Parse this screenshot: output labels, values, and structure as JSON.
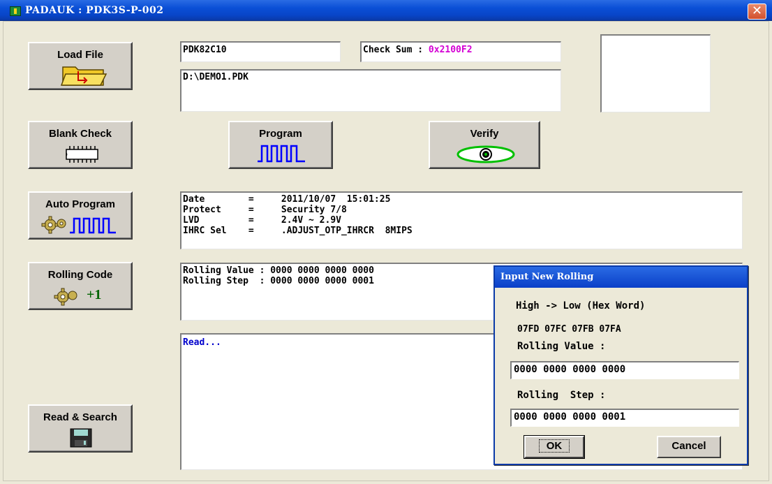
{
  "window": {
    "title": "PADAUK : PDK3S-P-002",
    "close": "✕"
  },
  "buttons": {
    "load_file": "Load File",
    "blank_check": "Blank Check",
    "program": "Program",
    "verify": "Verify",
    "auto_program": "Auto Program",
    "rolling_code": "Rolling Code",
    "rolling_code_increment": "+1",
    "read_search": "Read & Search"
  },
  "fields": {
    "ic_name": "PDK82C10",
    "checksum_label": "Check Sum : ",
    "checksum_value": "0x2100F2",
    "file_path": "D:\\DEMO1.PDK"
  },
  "info_lines": [
    "Date        =     2011/10/07  15:01:25",
    "Protect     =     Security 7/8",
    "LVD         =     2.4V ~ 2.9V",
    "IHRC Sel    =     .ADJUST_OTP_IHRCR  8MIPS"
  ],
  "rolling_lines": [
    "Rolling Value : 0000 0000 0000 0000",
    "Rolling Step  : 0000 0000 0000 0001"
  ],
  "log": {
    "text": "Read..."
  },
  "dialog": {
    "title": "Input New Rolling",
    "hint": "High -> Low (Hex Word)",
    "addresses": "07FD 07FC 07FB 07FA",
    "value_label": "Rolling Value :",
    "value": "0000 0000 0000 0000",
    "step_label": "Rolling  Step :",
    "step": "0000 0000 0000 0001",
    "ok": "OK",
    "cancel": "Cancel"
  },
  "colors": {
    "title_bar": "#0a4fd6",
    "checksum_value": "#d400d4",
    "log_text": "#0000cc",
    "program_wave": "#0000ff",
    "verify_eye": "#00c000",
    "rolling_plus": "#006400"
  },
  "icons": {
    "load_file": "folder-open-icon",
    "blank_check": "chip-icon",
    "program": "square-wave-icon",
    "verify": "eye-icon",
    "auto_program": "gear-wave-icon",
    "rolling_code": "gear-plus-icon",
    "read_search": "floppy-disk-icon"
  }
}
